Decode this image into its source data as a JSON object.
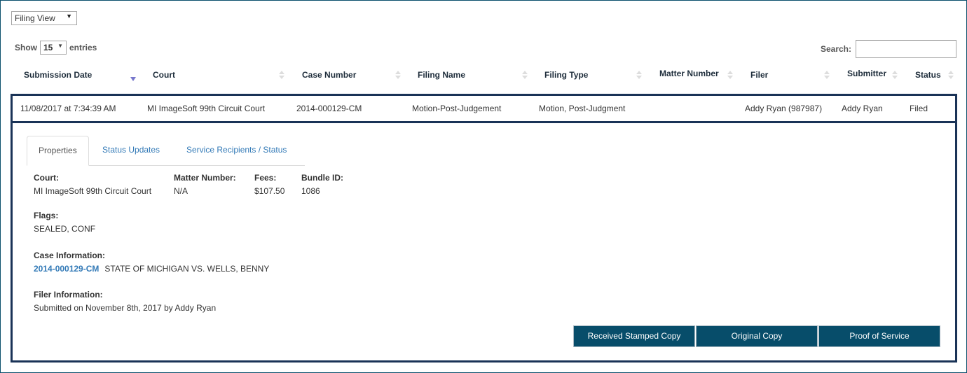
{
  "view_selector": {
    "value": "Filing View",
    "icon": "caret-down-icon"
  },
  "length_menu": {
    "prefix": "Show",
    "value": "15",
    "suffix": "entries"
  },
  "search": {
    "label": "Search:",
    "value": "",
    "placeholder": ""
  },
  "table": {
    "columns": [
      {
        "label": "Submission Date",
        "sort": "descending"
      },
      {
        "label": "Court",
        "sort": "none"
      },
      {
        "label": "Case Number",
        "sort": "none"
      },
      {
        "label": "Filing Name",
        "sort": "none"
      },
      {
        "label": "Filing Type",
        "sort": "none"
      },
      {
        "label": "Matter Number",
        "sort": "none"
      },
      {
        "label": "Filer",
        "sort": "none"
      },
      {
        "label": "Submitter",
        "sort": "none"
      },
      {
        "label": "Status",
        "sort": "none"
      }
    ],
    "rows": [
      {
        "submission_date": "11/08/2017 at 7:34:39 AM",
        "court": "MI ImageSoft 99th Circuit Court",
        "case_number": "2014-000129-CM",
        "filing_name": "Motion-Post-Judgement",
        "filing_type": "Motion, Post-Judgment",
        "matter_number": "",
        "filer": "Addy Ryan (987987)",
        "submitter": "Addy Ryan",
        "status": "Filed"
      }
    ]
  },
  "detail": {
    "tabs": [
      {
        "label": "Properties",
        "active": true
      },
      {
        "label": "Status Updates",
        "active": false
      },
      {
        "label": "Service Recipients / Status",
        "active": false
      }
    ],
    "properties": {
      "court": {
        "label": "Court:",
        "value": "MI ImageSoft 99th Circuit Court"
      },
      "matter_number": {
        "label": "Matter Number:",
        "value": "N/A"
      },
      "fees": {
        "label": "Fees:",
        "value": "$107.50"
      },
      "bundle_id": {
        "label": "Bundle ID:",
        "value": "1086"
      },
      "flags": {
        "label": "Flags:",
        "value": "SEALED, CONF"
      },
      "case_information": {
        "label": "Case Information:",
        "case_number": "2014-000129-CM",
        "case_title": "STATE OF MICHIGAN VS. WELLS, BENNY"
      },
      "filer_information": {
        "label": "Filer Information:",
        "value": "Submitted on November 8th, 2017 by Addy Ryan"
      }
    },
    "buttons": [
      {
        "label": "Received Stamped Copy"
      },
      {
        "label": "Original Copy"
      },
      {
        "label": "Proof of Service"
      }
    ]
  },
  "colors": {
    "primary_button": "#074d6a",
    "row_border": "#1a3357",
    "link": "#337ab7",
    "frame": "#0b4f6c"
  }
}
